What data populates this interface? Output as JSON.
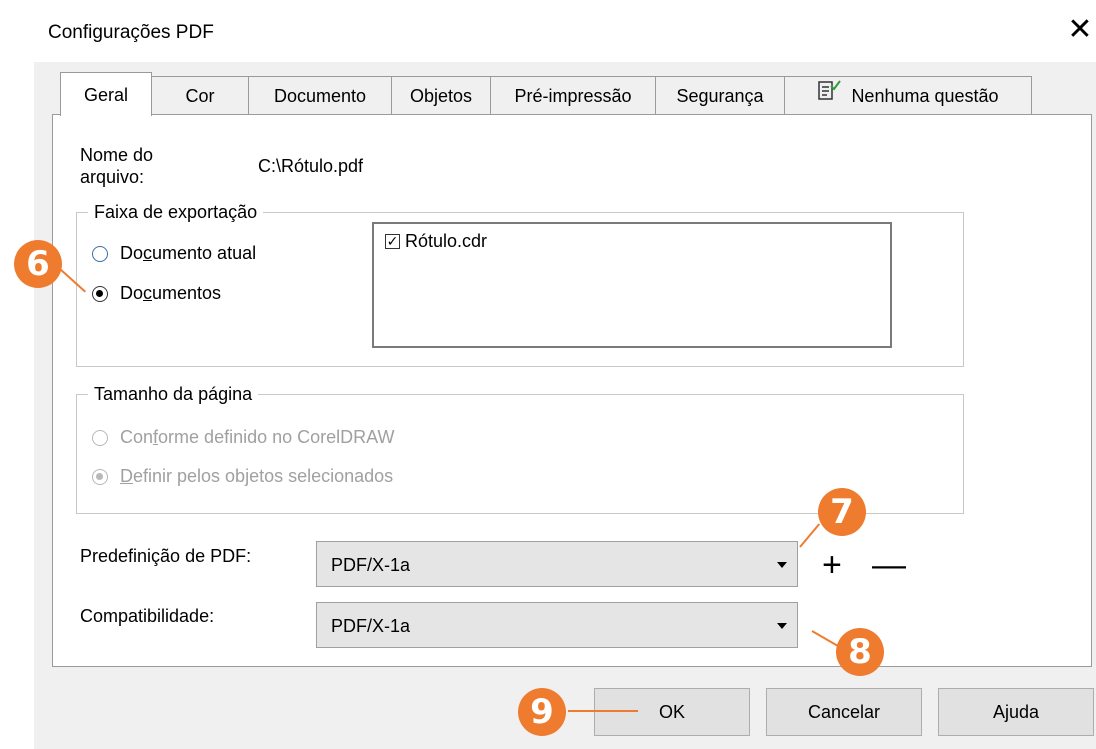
{
  "window": {
    "title": "Configurações PDF",
    "close_glyph": "✕"
  },
  "tabs": [
    {
      "label": "Geral",
      "active": true
    },
    {
      "label": "Cor"
    },
    {
      "label": "Documento"
    },
    {
      "label": "Objetos"
    },
    {
      "label": "Pré-impressão"
    },
    {
      "label": "Segurança"
    },
    {
      "label": "Nenhuma questão",
      "icon": "checklist-icon"
    }
  ],
  "general": {
    "filename_label_line1": "Nome do",
    "filename_label_line2": "arquivo:",
    "filename_value": "C:\\Rótulo.pdf"
  },
  "export_range": {
    "title": "Faixa de exportação",
    "option_current": {
      "pre": "Do",
      "ul": "c",
      "post": "umento atual",
      "checked": false
    },
    "option_documents": {
      "pre": "Do",
      "ul": "c",
      "post": "umentos",
      "checked": true
    },
    "documents": [
      {
        "name": "Rótulo.cdr",
        "checked": true
      }
    ]
  },
  "page_size": {
    "title": "Tamanho da página",
    "option_defined": {
      "pre": "Con",
      "ul": "f",
      "post": "orme definido no CorelDRAW",
      "checked": false,
      "disabled": true
    },
    "option_selected": {
      "pre": "",
      "ul": "D",
      "post": "efinir pelos objetos selecionados",
      "checked": true,
      "disabled": true
    }
  },
  "preset": {
    "label": "Predefinição de PDF:",
    "value": "PDF/X-1a",
    "add_glyph": "+",
    "remove_glyph": "—"
  },
  "compatibility": {
    "label": "Compatibilidade:",
    "value": "PDF/X-1a"
  },
  "buttons": {
    "ok": "OK",
    "cancel": "Cancelar",
    "help": "Ajuda"
  },
  "callouts": {
    "six": "6",
    "seven": "7",
    "eight": "8",
    "nine": "9",
    "color": "#ef7b2f"
  }
}
